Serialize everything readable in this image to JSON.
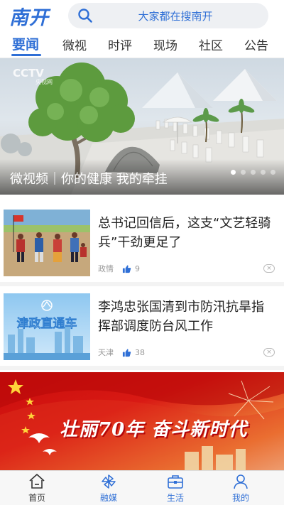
{
  "header": {
    "logo_text": "南开",
    "search_placeholder": "大家都在搜南开"
  },
  "tabs": [
    {
      "label": "要闻",
      "active": true
    },
    {
      "label": "微视",
      "active": false
    },
    {
      "label": "时评",
      "active": false
    },
    {
      "label": "现场",
      "active": false
    },
    {
      "label": "社区",
      "active": false
    },
    {
      "label": "公告",
      "active": false
    }
  ],
  "banner": {
    "caption": "微视频｜你的健康 我的牵挂",
    "watermark": "CCTV",
    "watermark_sub": "央视网",
    "slide_count": 5,
    "active_slide": 1
  },
  "news": [
    {
      "title": "总书记回信后，这支“文艺轻骑兵”干劲更足了",
      "source": "政情",
      "likes": "9"
    },
    {
      "title": "李鸿忠张国清到市防汛抗旱指挥部调度防台风工作",
      "source": "天津",
      "likes": "38",
      "thumb_text": "津政直通车"
    }
  ],
  "promo": {
    "slogan": "壮丽70年 奋斗新时代"
  },
  "bottom_nav": [
    {
      "label": "首页",
      "icon": "home-icon"
    },
    {
      "label": "融媒",
      "icon": "pinwheel-icon"
    },
    {
      "label": "生活",
      "icon": "briefcase-icon"
    },
    {
      "label": "我的",
      "icon": "user-icon"
    }
  ],
  "colors": {
    "accent": "#2f6fd6",
    "promo_red": "#c80c0c"
  }
}
